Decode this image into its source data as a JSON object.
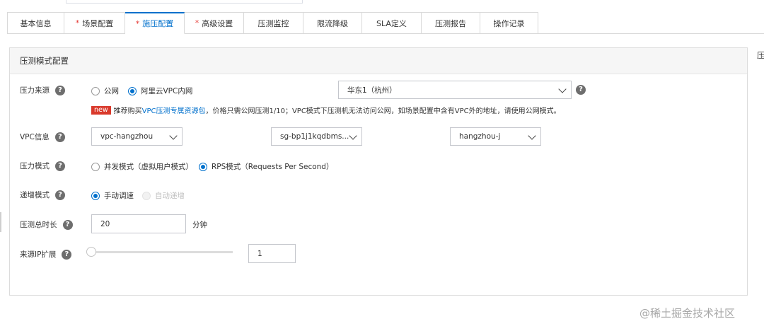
{
  "tabs": [
    {
      "label": "基本信息",
      "required": false,
      "active": false
    },
    {
      "label": "场景配置",
      "required": true,
      "active": false
    },
    {
      "label": "施压配置",
      "required": true,
      "active": true
    },
    {
      "label": "高级设置",
      "required": true,
      "active": false
    },
    {
      "label": "压测监控",
      "required": false,
      "active": false
    },
    {
      "label": "限流降级",
      "required": false,
      "active": false
    },
    {
      "label": "SLA定义",
      "required": false,
      "active": false
    },
    {
      "label": "压测报告",
      "required": false,
      "active": false
    },
    {
      "label": "操作记录",
      "required": false,
      "active": false
    }
  ],
  "required_mark": "*",
  "panel": {
    "title": "压测模式配置"
  },
  "right_edge_text": "压",
  "form": {
    "source": {
      "label": "压力来源",
      "options": [
        "公网",
        "阿里云VPC内网"
      ],
      "selected": "阿里云VPC内网",
      "region": "华东1（杭州）"
    },
    "tip": {
      "badge": "new",
      "prefix": "推荐购买",
      "link": "VPC压测专属资源包",
      "suffix": "，价格只需公网压测1/10；VPC模式下压测机无法访问公网，如场景配置中含有VPC外的地址，请使用公网模式。"
    },
    "vpc": {
      "label": "VPC信息",
      "vpc_value": "vpc-hangzhou",
      "sg_value": "sg-bp1j1kqdbms...",
      "vswitch_value": "hangzhou-j"
    },
    "mode": {
      "label": "压力模式",
      "options": [
        "并发模式（虚拟用户模式）",
        "RPS模式（Requests Per Second）"
      ],
      "selected": "RPS模式（Requests Per Second）"
    },
    "ramp": {
      "label": "递增模式",
      "options": [
        "手动调速",
        "自动递增"
      ],
      "selected": "手动调速",
      "disabled": [
        "自动递增"
      ]
    },
    "duration": {
      "label": "压测总时长",
      "value": "20",
      "unit": "分钟"
    },
    "ip_expand": {
      "label": "来源IP扩展",
      "value": "1",
      "slider_fraction": 0
    }
  },
  "watermark": "@稀土掘金技术社区",
  "colors": {
    "accent": "#0070cc",
    "required": "#e53935",
    "badge": "#d9392b"
  }
}
